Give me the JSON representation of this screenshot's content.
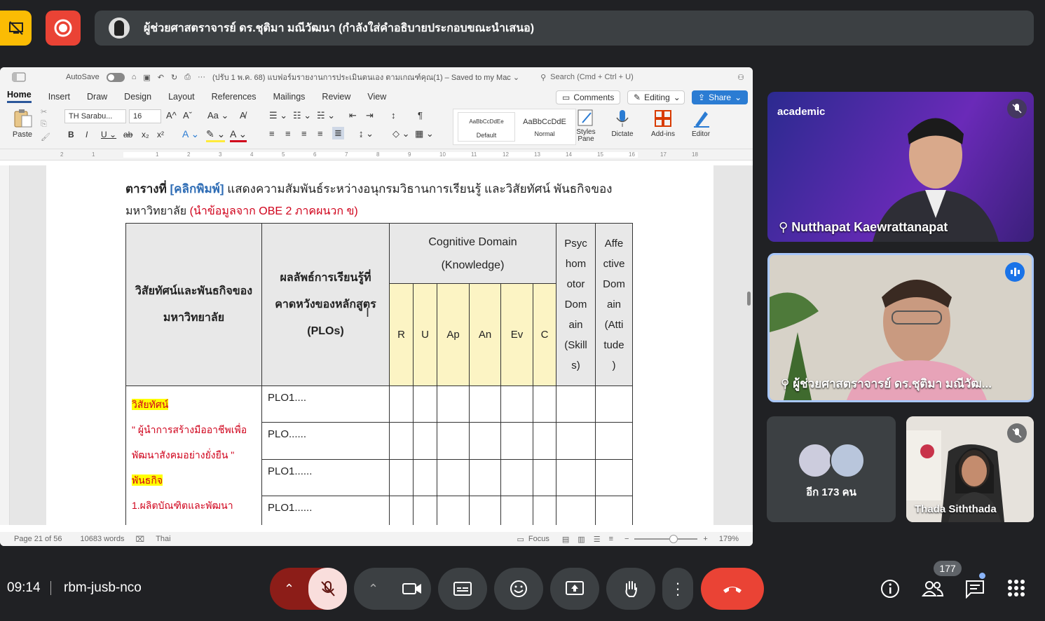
{
  "presenter_banner": "ผู้ช่วยศาสตราจารย์ ดร.ชุติมา มณีวัฒนา (กำลังใส่คำอธิบายประกอบขณะนำเสนอ)",
  "word": {
    "autosave_label": "AutoSave",
    "doc_title": "(ปรับ 1 พ.ค. 68) แบฟอร์มรายงานการประเมินตนเอง ตามเกณฑ์คุณ(1) – Saved to my Mac ⌄",
    "search_placeholder": "Search (Cmd + Ctrl + U)",
    "tabs": [
      "Home",
      "Insert",
      "Draw",
      "Design",
      "Layout",
      "References",
      "Mailings",
      "Review",
      "View"
    ],
    "comments_label": "Comments",
    "editing_label": "Editing",
    "share_label": "Share",
    "paste_label": "Paste",
    "font_name": "TH Sarabu...",
    "font_size": "16",
    "style1_sample": "AaBbCcDdEe",
    "style1_label": "Default",
    "style2_sample": "AaBbCcDdE",
    "style2_label": "Normal",
    "styles_pane_label": "Styles Pane",
    "dictate_label": "Dictate",
    "addins_label": "Add-ins",
    "editor_label": "Editor",
    "ruler_numbers": [
      "2",
      "1",
      "1",
      "2",
      "3",
      "4",
      "5",
      "6",
      "7",
      "8",
      "9",
      "10",
      "11",
      "12",
      "13",
      "14",
      "15",
      "16",
      "17",
      "18"
    ],
    "status": {
      "page": "Page 21 of 56",
      "words": "10683 words",
      "language": "Thai",
      "focus": "Focus",
      "zoom": "179%"
    }
  },
  "doc": {
    "caption_prefix": "ตารางที่",
    "caption_click": "[คลิกพิมพ์]",
    "caption_rest": "แสดงความสัมพันธ์ระหว่างอนุกรมวิธานการเรียนรู้ และวิสัยทัศน์ พันธกิจของ",
    "caption_line2": "มหาวิทยาลัย",
    "caption_note": "(นำข้อมูลจาก OBE 2 ภาคผนวก ข)",
    "table": {
      "col1_header": "วิสัยทัศน์และพันธกิจของมหาวิทยาลัย",
      "col2_header": "ผลลัพธ์การเรียนรู้ที่คาดหวังของหลักสูตร (PLOs)",
      "cognitive_header": "Cognitive Domain (Knowledge)",
      "psycho_header": "Psyc hom otor Dom ain (Skill s)",
      "affective_header": "Affe ctive Dom ain (Atti tude )",
      "sub_cols": [
        "R",
        "U",
        "Ap",
        "An",
        "Ev",
        "C"
      ],
      "vision_label": "วิสัยทัศน์",
      "vision_text": "\" ผู้นำการสร้างมืออาชีพเพื่อพัฒนาสังคมอย่างยั่งยืน \"",
      "mission_label": "พันธกิจ",
      "mission_text": "1.ผลิตบัณฑิตและพัฒนา",
      "plo_rows": [
        "PLO1....",
        "PLO......",
        "PLO1......",
        "PLO1......"
      ]
    }
  },
  "participants": [
    {
      "name": "Nutthapat Kaewrattanapat",
      "muted": true
    },
    {
      "name": "ผู้ช่วยศาสตราจารย์ ดร.ชุติมา มณีวัฒ...",
      "speaking": true
    },
    {
      "name": "อีก 173 คน"
    },
    {
      "name": "Thada Siththada",
      "muted": true
    }
  ],
  "slide_logo": "academic",
  "bottom": {
    "time": "09:14",
    "meeting_code": "rbm-jusb-nco",
    "people_count": "177"
  }
}
